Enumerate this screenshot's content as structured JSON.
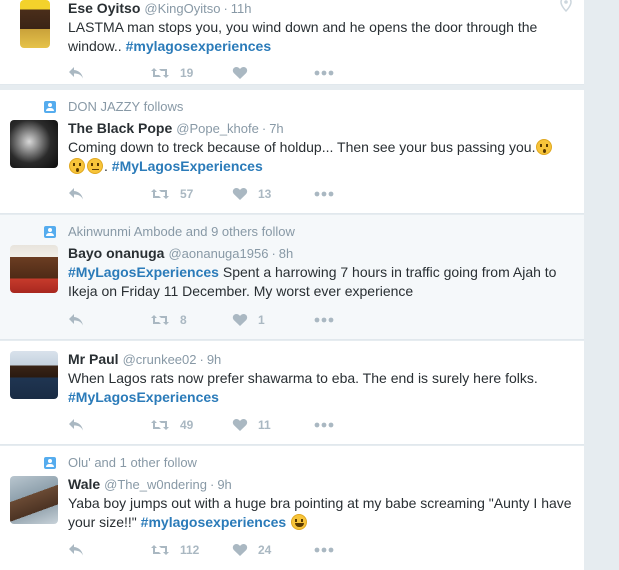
{
  "tweets": [
    {
      "context": "",
      "name": "Ese Oyitso",
      "handle": "@KingOyitso",
      "time": "11h",
      "text_before": "LASTMA man stops you, you wind down and he opens the door through the window.. ",
      "hashtag": "#mylagosexperiences",
      "text_after": "",
      "retweets": "19",
      "likes": ""
    },
    {
      "context": "DON JAZZY follows",
      "name": "The Black Pope",
      "handle": "@Pope_khofe",
      "time": "7h",
      "text_before": "Coming down to treck because of holdup... Then see your bus passing you.",
      "hashtag": "#MyLagosExperiences",
      "text_after": "",
      "retweets": "57",
      "likes": "13"
    },
    {
      "context": "Akinwunmi Ambode and 9 others follow",
      "name": "Bayo onanuga",
      "handle": "@aonanuga1956",
      "time": "8h",
      "text_before": "",
      "hashtag": "#MyLagosExperiences",
      "text_after": " Spent a harrowing 7 hours in traffic going from Ajah to Ikeja on Friday 11 December. My worst ever experience",
      "retweets": "8",
      "likes": "1"
    },
    {
      "context": "",
      "name": "Mr Paul",
      "handle": "@crunkee02",
      "time": "9h",
      "text_before": "When Lagos rats now prefer shawarma to eba. The end is surely here folks.",
      "hashtag": "#MyLagosExperiences",
      "text_after": "",
      "retweets": "49",
      "likes": "11"
    },
    {
      "context": "Olu' and 1 other follow",
      "name": "Wale",
      "handle": "@The_w0ndering",
      "time": "9h",
      "text_before": "Yaba boy jumps out with a huge bra pointing at my babe screaming \"Aunty I have your size!!\" ",
      "hashtag": "#mylagosexperiences",
      "text_after": "",
      "retweets": "112",
      "likes": "24"
    }
  ],
  "colors": {
    "hashtag": "#2b7bb9",
    "muted": "#8899a6",
    "action_icon": "#aab8c2",
    "context_icon": "#55acee"
  },
  "icons": [
    "reply-icon",
    "retweet-icon",
    "heart-icon",
    "more-icon",
    "follow-context-icon",
    "location-pin-icon"
  ]
}
